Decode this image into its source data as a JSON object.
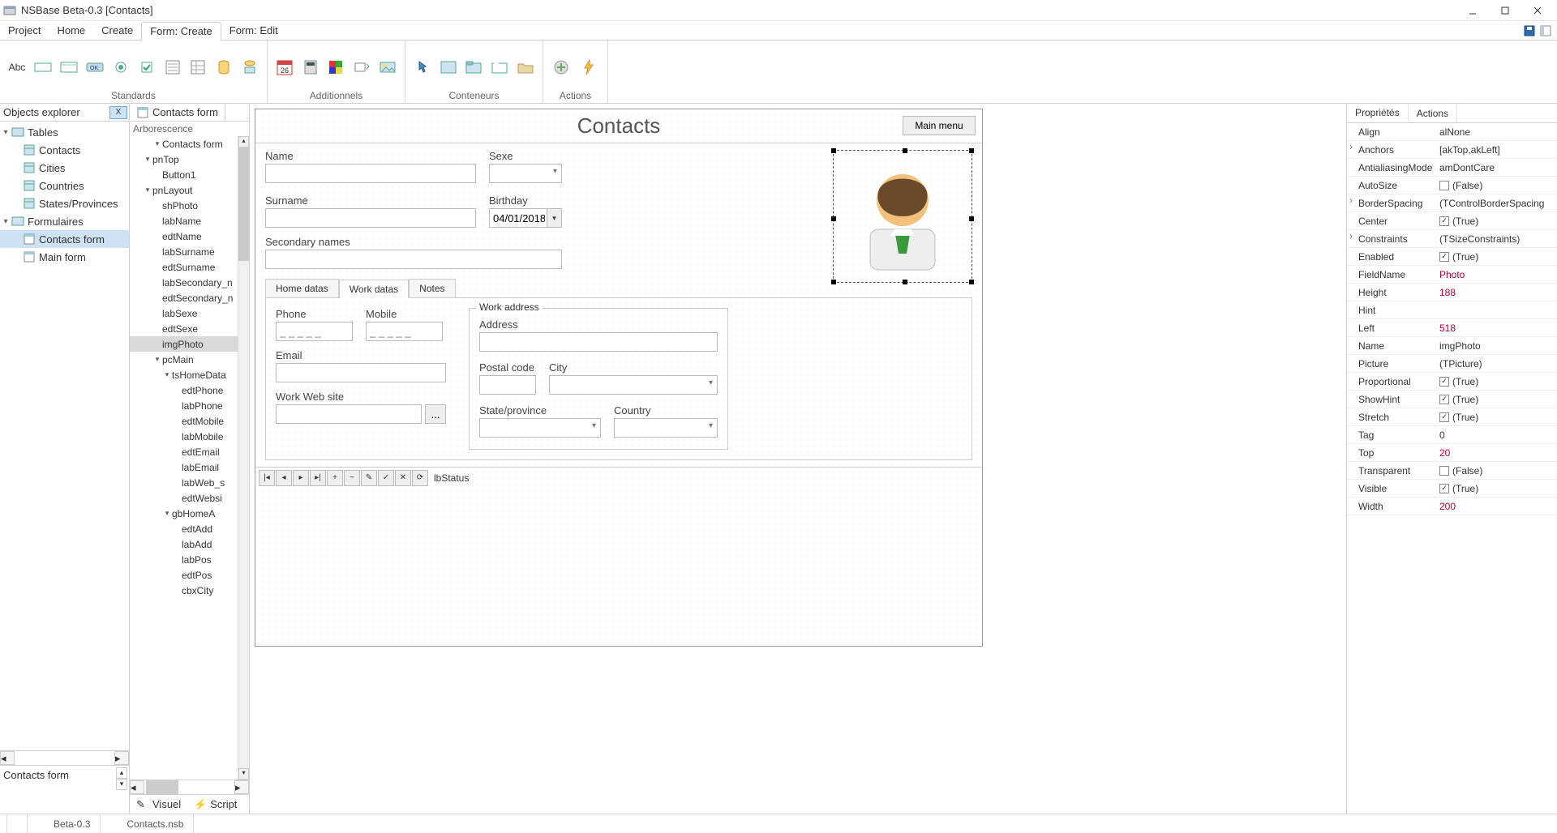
{
  "window": {
    "title": "NSBase Beta-0.3 [Contacts]"
  },
  "menu": [
    "Project",
    "Home",
    "Create",
    "Form: Create",
    "Form: Edit"
  ],
  "menu_active_index": 3,
  "ribbon": {
    "groups": [
      {
        "name": "Standards"
      },
      {
        "name": "Additionnels"
      },
      {
        "name": "Conteneurs"
      },
      {
        "name": "Actions"
      }
    ]
  },
  "explorer": {
    "title": "Objects explorer",
    "close": "X",
    "nodes": {
      "tables": "Tables",
      "contacts": "Contacts",
      "cities": "Cities",
      "countries": "Countries",
      "states": "States/Provinces",
      "formulaires": "Formulaires",
      "contacts_form": "Contacts form",
      "main_form": "Main form"
    },
    "bottom_label": "Contacts form"
  },
  "arbo": {
    "tab": "Contacts form",
    "heading": "Arborescence",
    "items": [
      "Contacts form",
      "pnTop",
      "Button1",
      "pnLayout",
      "shPhoto",
      "labName",
      "edtName",
      "labSurname",
      "edtSurname",
      "labSecondary_n",
      "edtSecondary_n",
      "labSexe",
      "edtSexe",
      "imgPhoto",
      "pcMain",
      "tsHomeData",
      "edtPhone",
      "labPhone",
      "edtMobile",
      "labMobile",
      "edtEmail",
      "labEmail",
      "labWeb_s",
      "edtWebsi",
      "gbHomeA",
      "edtAdd",
      "labAdd",
      "labPos",
      "edtPos",
      "cbxCity"
    ],
    "selected": "imgPhoto",
    "footer_tabs": {
      "visuel": "Visuel",
      "script": "Script"
    }
  },
  "form": {
    "title": "Contacts",
    "main_menu": "Main menu",
    "labels": {
      "name": "Name",
      "sexe": "Sexe",
      "surname": "Surname",
      "birthday": "Birthday",
      "secondary": "Secondary names",
      "phone": "Phone",
      "mobile": "Mobile",
      "email": "Email",
      "website": "Work Web site",
      "workaddress": "Work address",
      "address": "Address",
      "postal": "Postal code",
      "city": "City",
      "state": "State/province",
      "country": "Country"
    },
    "values": {
      "birthday": "04/01/2018"
    },
    "tabs": [
      "Home datas",
      "Work datas",
      "Notes"
    ],
    "active_tab": 1,
    "status_label": "lbStatus"
  },
  "props": {
    "tabs": [
      "Propriétés",
      "Actions"
    ],
    "active_tab": 0,
    "rows": [
      {
        "name": "Align",
        "val": "alNone",
        "exp": false
      },
      {
        "name": "Anchors",
        "val": "[akTop,akLeft]",
        "exp": true
      },
      {
        "name": "AntialiasingMode",
        "val": "amDontCare",
        "exp": false
      },
      {
        "name": "AutoSize",
        "val": "(False)",
        "check": false
      },
      {
        "name": "BorderSpacing",
        "val": "(TControlBorderSpacing",
        "exp": true
      },
      {
        "name": "Center",
        "val": "(True)",
        "check": true
      },
      {
        "name": "Constraints",
        "val": "(TSizeConstraints)",
        "exp": true
      },
      {
        "name": "Enabled",
        "val": "(True)",
        "check": true
      },
      {
        "name": "FieldName",
        "val": "Photo",
        "cls": "num"
      },
      {
        "name": "Height",
        "val": "188",
        "cls": "num"
      },
      {
        "name": "Hint",
        "val": ""
      },
      {
        "name": "Left",
        "val": "518",
        "cls": "num"
      },
      {
        "name": "Name",
        "val": "imgPhoto"
      },
      {
        "name": "Picture",
        "val": "(TPicture)"
      },
      {
        "name": "Proportional",
        "val": "(True)",
        "check": true
      },
      {
        "name": "ShowHint",
        "val": "(True)",
        "check": true
      },
      {
        "name": "Stretch",
        "val": "(True)",
        "check": true
      },
      {
        "name": "Tag",
        "val": "0"
      },
      {
        "name": "Top",
        "val": "20",
        "cls": "num"
      },
      {
        "name": "Transparent",
        "val": "(False)",
        "check": false
      },
      {
        "name": "Visible",
        "val": "(True)",
        "check": true
      },
      {
        "name": "Width",
        "val": "200",
        "cls": "num"
      }
    ]
  },
  "statusbar": {
    "version": "Beta-0.3",
    "file": "Contacts.nsb"
  }
}
